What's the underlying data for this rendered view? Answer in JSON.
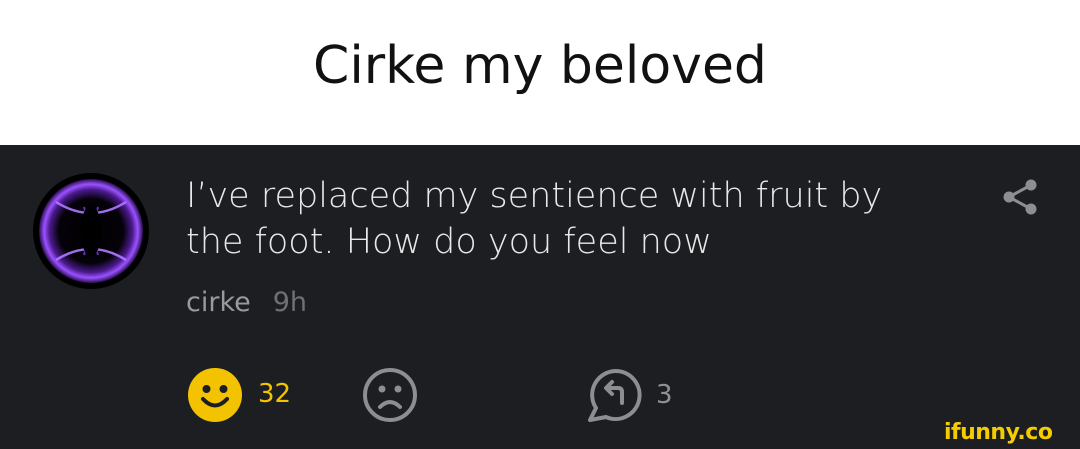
{
  "header": {
    "title": "Cirke my beloved"
  },
  "post": {
    "text": "I’ve replaced my sentience with fruit by the foot. How do you feel now",
    "author": "cirke",
    "time": "9h",
    "avatar_icon": "purple-portal-avatar",
    "share_icon": "share-icon"
  },
  "actions": {
    "smile_count": "32",
    "smile_icon": "smile-icon",
    "frown_icon": "frown-icon",
    "reply_icon": "reply-icon",
    "reply_count": "3"
  },
  "watermark": {
    "text": "ifunny.co"
  },
  "colors": {
    "card_bg": "#1d1e22",
    "smile_accent": "#f3c200",
    "avatar_glow": "#8a3cff"
  }
}
